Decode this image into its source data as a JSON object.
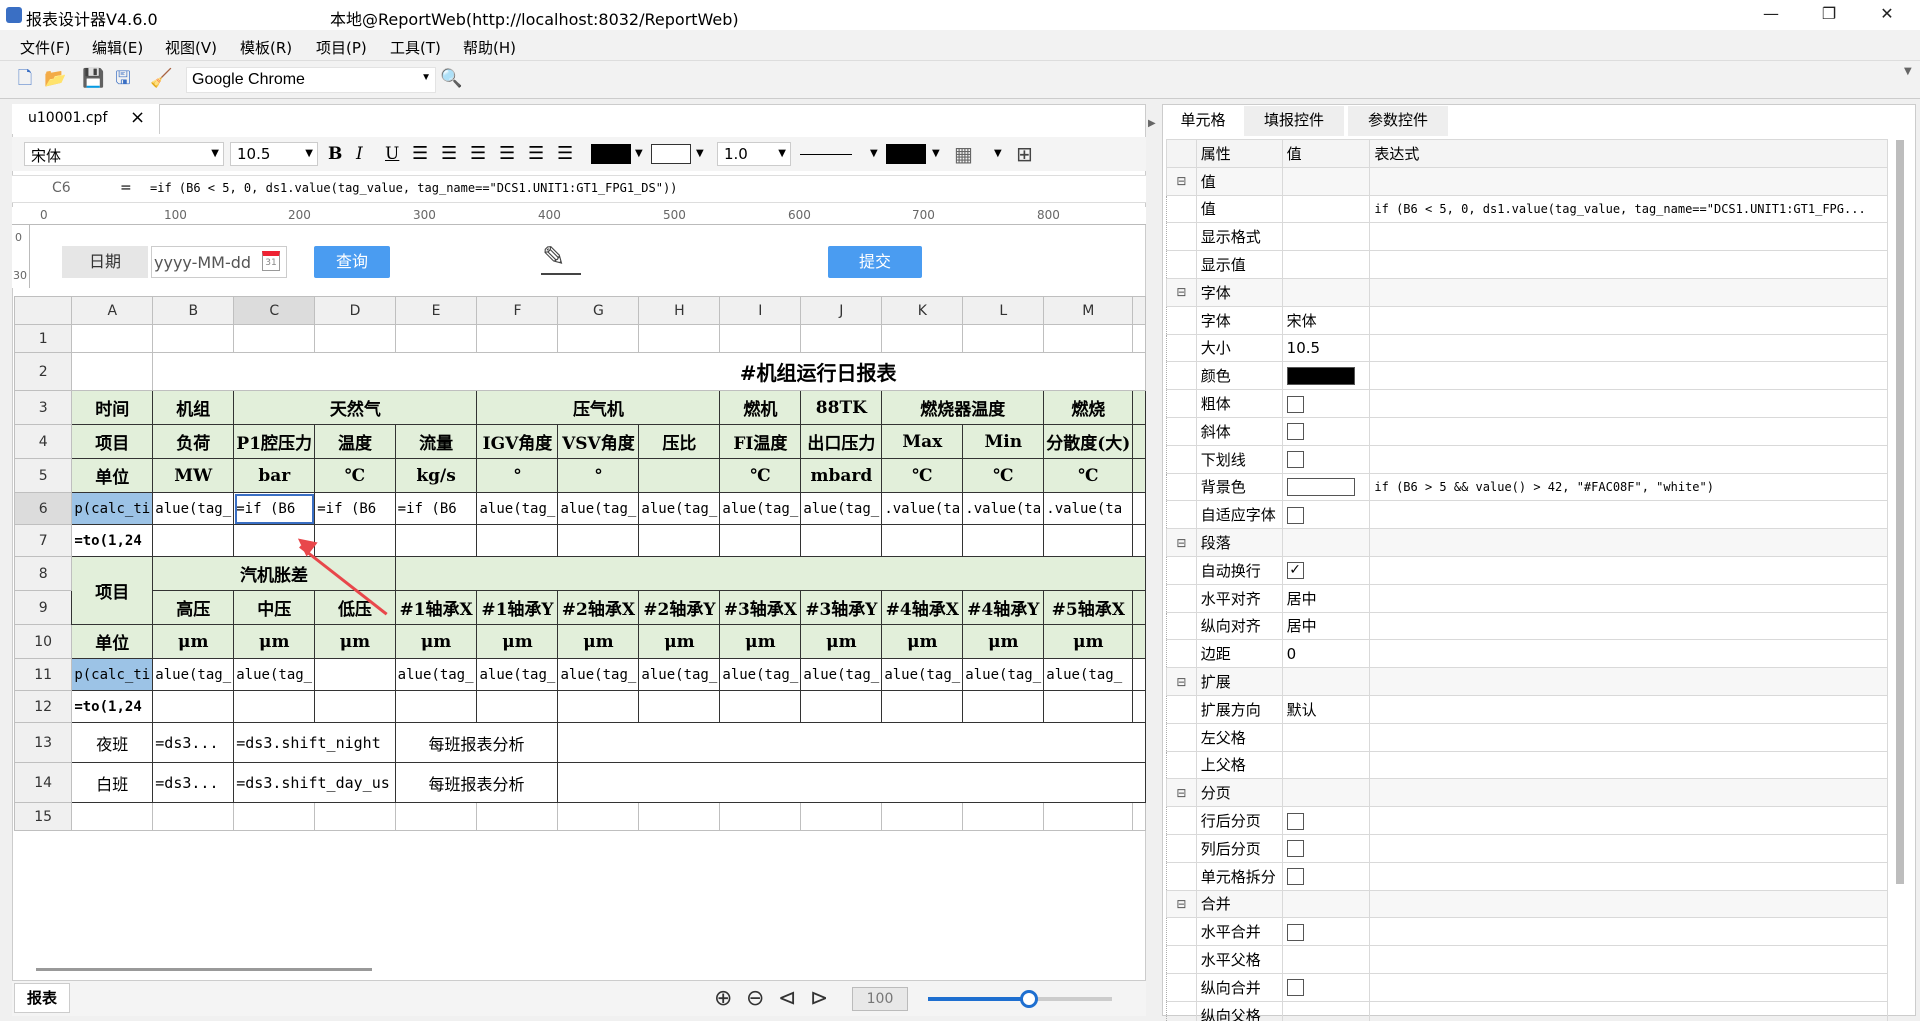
{
  "app": {
    "title": "报表设计器V4.6.0",
    "location": "本地@ReportWeb(http://localhost:8032/ReportWeb)"
  },
  "menu": [
    "文件(F)",
    "编辑(E)",
    "视图(V)",
    "模板(R)",
    "项目(P)",
    "工具(T)",
    "帮助(H)"
  ],
  "toolbar": {
    "browser": "Google Chrome"
  },
  "doc_tab": {
    "name": "u10001.cpf",
    "close": "×"
  },
  "format": {
    "font": "宋体",
    "size": "10.5",
    "bold": "B",
    "italic": "I",
    "underline": "U",
    "line_width": "1.0"
  },
  "formula": {
    "cell": "C6",
    "eq": "=",
    "text": "=if (B6 < 5, 0, ds1.value(tag_value, tag_name==\"DCS1.UNIT1:GT1_FPG1_DS\"))"
  },
  "ruler": {
    "marks": [
      "0",
      "100",
      "200",
      "300",
      "400",
      "500",
      "600",
      "700",
      "800"
    ],
    "v_marks": [
      "0",
      "30"
    ]
  },
  "query": {
    "date_label": "日期",
    "date_placeholder": "yyyy-MM-dd",
    "query_btn": "查询",
    "submit_btn": "提交"
  },
  "sheet": {
    "col_headers": [
      "A",
      "B",
      "C",
      "D",
      "E",
      "F",
      "G",
      "H",
      "I",
      "J",
      "K",
      "L",
      "M"
    ],
    "title": "#机组运行日报表",
    "r3": [
      "时间",
      "机组",
      "天然气",
      "压气机",
      "燃机",
      "88TK",
      "燃烧器温度",
      "燃烧"
    ],
    "r4": [
      "项目",
      "负荷",
      "P1腔压力",
      "温度",
      "流量",
      "IGV角度",
      "VSV角度",
      "压比",
      "FI温度",
      "出口压力",
      "Max",
      "Min",
      "分散度(大)"
    ],
    "r5": [
      "单位",
      "MW",
      "bar",
      "℃",
      "kg/s",
      "°",
      "°",
      "",
      "℃",
      "mbard",
      "℃",
      "℃",
      "℃"
    ],
    "r6": [
      "p(calc_ti",
      "alue(tag_",
      "=if (B6",
      "=if (B6",
      "=if (B6",
      "alue(tag_",
      "alue(tag_",
      "alue(tag_",
      "alue(tag_",
      "alue(tag_",
      ".value(ta",
      ".value(ta",
      ".value(ta"
    ],
    "r7": "=to(1,24",
    "r8": [
      "项目",
      "汽机胀差"
    ],
    "r9": [
      "高压",
      "中压",
      "低压",
      "#1轴承X",
      "#1轴承Y",
      "#2轴承X",
      "#2轴承Y",
      "#3轴承X",
      "#3轴承Y",
      "#4轴承X",
      "#4轴承Y",
      "#5轴承X"
    ],
    "r10": [
      "单位",
      "μm",
      "μm",
      "μm",
      "μm",
      "μm",
      "μm",
      "μm",
      "μm",
      "μm",
      "μm",
      "μm",
      "μm"
    ],
    "r11": [
      "p(calc_ti",
      "alue(tag_",
      "alue(tag_",
      "",
      "alue(tag_",
      "alue(tag_",
      "alue(tag_",
      "alue(tag_",
      "alue(tag_",
      "alue(tag_",
      "alue(tag_",
      "alue(tag_",
      "alue(tag_"
    ],
    "r12": "=to(1,24",
    "r13": [
      "夜班",
      "=ds3...",
      "=ds3.shift_night",
      "每班报表分析"
    ],
    "r14": [
      "白班",
      "=ds3...",
      "=ds3.shift_day_us",
      "每班报表分析"
    ],
    "row_nums": [
      "1",
      "2",
      "3",
      "4",
      "5",
      "6",
      "7",
      "8",
      "9",
      "10",
      "11",
      "12",
      "13",
      "14",
      "15"
    ]
  },
  "bottom": {
    "sheet_tab": "报表",
    "zoom": "100"
  },
  "panel": {
    "tabs": [
      "单元格",
      "填报控件",
      "参数控件"
    ],
    "headers": [
      "属性",
      "值",
      "表达式"
    ],
    "rows": [
      {
        "type": "group",
        "label": "值"
      },
      {
        "label": "值",
        "value": "",
        "expr": "if (B6 < 5, 0, ds1.value(tag_value, tag_name==\"DCS1.UNIT1:GT1_FPG..."
      },
      {
        "label": "显示格式",
        "value": "",
        "expr": ""
      },
      {
        "label": "显示值",
        "value": "",
        "expr": ""
      },
      {
        "type": "group",
        "label": "字体"
      },
      {
        "label": "字体",
        "value": "宋体",
        "expr": ""
      },
      {
        "label": "大小",
        "value": "10.5",
        "expr": ""
      },
      {
        "label": "颜色",
        "swatch": "#000000",
        "expr": ""
      },
      {
        "label": "粗体",
        "check": false,
        "expr": ""
      },
      {
        "label": "斜体",
        "check": false,
        "expr": ""
      },
      {
        "label": "下划线",
        "check": false,
        "expr": ""
      },
      {
        "label": "背景色",
        "swatch": "#ffffff",
        "expr": "if (B6 > 5 && value() > 42, \"#FAC08F\", \"white\")"
      },
      {
        "label": "自适应字体",
        "check": false,
        "expr": ""
      },
      {
        "type": "group",
        "label": "段落"
      },
      {
        "label": "自动换行",
        "check": true,
        "expr": ""
      },
      {
        "label": "水平对齐",
        "value": "居中",
        "expr": ""
      },
      {
        "label": "纵向对齐",
        "value": "居中",
        "expr": ""
      },
      {
        "label": "边距",
        "value": "0",
        "expr": ""
      },
      {
        "type": "group",
        "label": "扩展"
      },
      {
        "label": "扩展方向",
        "value": "默认",
        "expr": ""
      },
      {
        "label": "左父格",
        "value": "",
        "expr": ""
      },
      {
        "label": "上父格",
        "value": "",
        "expr": ""
      },
      {
        "type": "group",
        "label": "分页"
      },
      {
        "label": "行后分页",
        "check": false,
        "expr": ""
      },
      {
        "label": "列后分页",
        "check": false,
        "expr": ""
      },
      {
        "label": "单元格拆分",
        "check": false,
        "expr": ""
      },
      {
        "type": "group",
        "label": "合并"
      },
      {
        "label": "水平合并",
        "check": false,
        "expr": ""
      },
      {
        "label": "水平父格",
        "value": "",
        "expr": ""
      },
      {
        "label": "纵向合并",
        "check": false,
        "expr": ""
      },
      {
        "label": "纵向父格",
        "value": "",
        "expr": ""
      }
    ]
  },
  "colors": {
    "header_green": "#e2efda",
    "selected_blue": "#9cc3e6",
    "button_blue": "#4a9cf1",
    "arrow_red": "#e8474b"
  }
}
